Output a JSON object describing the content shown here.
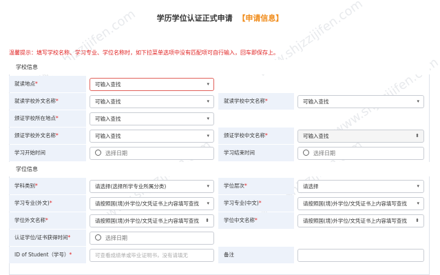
{
  "page": {
    "title": "学历学位认证正式申请",
    "title_tag": "【申请信息】",
    "notice": "温馨提示：填写学校名称、学习专业、学位名称时，如下拉菜单选项中没有匹配项可自行输入，回车即保存上。"
  },
  "sections": {
    "school": "学校信息",
    "degree": "学位信息"
  },
  "fields": {
    "study_location": {
      "label": "就读地点",
      "value": "可输入查找"
    },
    "school_foreign_name": {
      "label": "就读学校外文名称",
      "value": "可输入查找"
    },
    "school_chinese_name": {
      "label": "就读学校中文名称",
      "value": "可输入查找"
    },
    "issuing_school_location": {
      "label": "颁证学校所在地点",
      "value": "可输入查找"
    },
    "issuing_school_foreign_name": {
      "label": "颁证学校外文名称",
      "value": "可输入查找"
    },
    "issuing_school_chinese_name": {
      "label": "颁证学校中文名称",
      "value": "可输入查找"
    },
    "study_start": {
      "label": "学习开始时间",
      "placeholder": "选择日期"
    },
    "study_end": {
      "label": "学习结束时间",
      "placeholder": "选择日期"
    },
    "subject_category": {
      "label": "学科类别",
      "value": "请选择(选择所学专业所属分类)"
    },
    "degree_level": {
      "label": "学位层次",
      "value": "请选择"
    },
    "major_foreign": {
      "label": "学习专业(外文)",
      "value": "请按照国(境)外学位/文凭证书上内容填写查找"
    },
    "major_chinese": {
      "label": "学习专业(中文)",
      "value": "请按照国(境)外学位/文凭证书上内容填写查找"
    },
    "degree_foreign_name": {
      "label": "学位外文名称",
      "value": "请按照国(境)外学位/文凭证书上内容填写查找"
    },
    "degree_chinese_name": {
      "label": "学位中文名称",
      "value": "请按照国(境)外学位/文凭证书上内容填写查找"
    },
    "certificate_date": {
      "label": "认证学位/证书获得时间",
      "placeholder": "选择日期"
    },
    "student_id": {
      "label": "ID of Student（学号）",
      "placeholder": "可查看成绩单或毕业证明书，没有请填无"
    },
    "remarks": {
      "label": "备注",
      "value": ""
    }
  },
  "watermark": "www.shjzzijifen.com"
}
